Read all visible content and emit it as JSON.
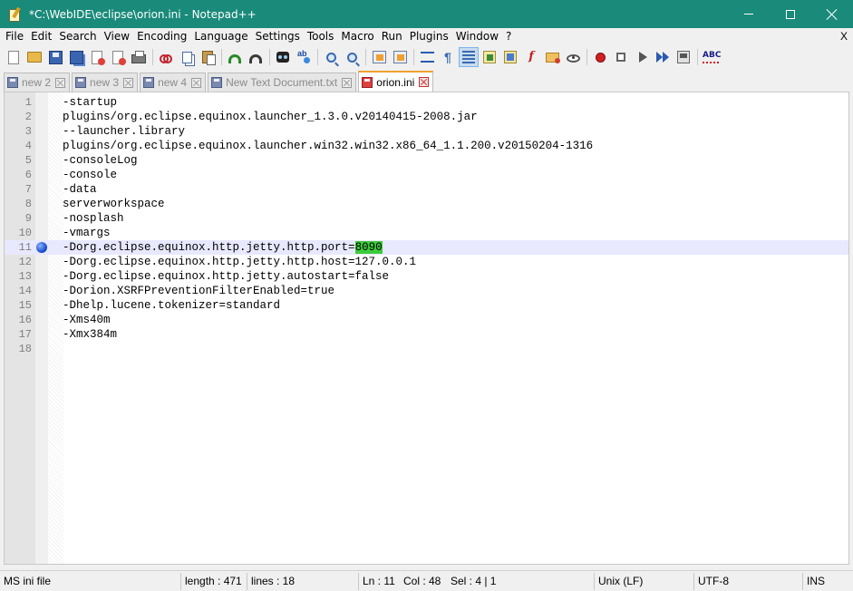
{
  "window": {
    "title": "*C:\\WebIDE\\eclipse\\orion.ini - Notepad++"
  },
  "menu": {
    "items": [
      "File",
      "Edit",
      "Search",
      "View",
      "Encoding",
      "Language",
      "Settings",
      "Tools",
      "Macro",
      "Run",
      "Plugins",
      "Window",
      "?"
    ],
    "close_label": "X"
  },
  "toolbar": {
    "buttons": [
      "new-file",
      "open-file",
      "save",
      "save-all",
      "close",
      "close-all",
      "print",
      "cut",
      "copy",
      "paste",
      "undo",
      "redo",
      "find",
      "replace",
      "zoom-in",
      "zoom-out",
      "sync-scroll-v",
      "sync-scroll-h",
      "word-wrap",
      "show-all-chars",
      "indent-guide",
      "fold-all",
      "user-defined-language",
      "function-list",
      "folder-as-workspace",
      "document-monitor",
      "start-recording",
      "stop-recording",
      "playback",
      "run-macro-multiple",
      "save-macro",
      "spell-check"
    ],
    "spell_label": "ABC"
  },
  "tabs": [
    {
      "label": "new 2",
      "active": false
    },
    {
      "label": "new 3",
      "active": false
    },
    {
      "label": "new 4",
      "active": false
    },
    {
      "label": "New Text Document.txt",
      "active": false
    },
    {
      "label": "orion.ini",
      "active": true
    }
  ],
  "editor": {
    "current_line": 11,
    "bookmark_line": 11,
    "lines": [
      "-startup",
      "plugins/org.eclipse.equinox.launcher_1.3.0.v20140415-2008.jar",
      "--launcher.library",
      "plugins/org.eclipse.equinox.launcher.win32.win32.x86_64_1.1.200.v20150204-1316",
      "-consoleLog",
      "-console",
      "-data",
      "serverworkspace",
      "-nosplash",
      "-vmargs",
      "-Dorg.eclipse.equinox.http.jetty.http.port=8090",
      "-Dorg.eclipse.equinox.http.jetty.http.host=127.0.0.1",
      "-Dorg.eclipse.equinox.http.jetty.autostart=false",
      "-Dorion.XSRFPreventionFilterEnabled=true",
      "-Dhelp.lucene.tokenizer=standard",
      "-Xms40m",
      "-Xmx384m",
      ""
    ],
    "selection": {
      "line": 11,
      "text": "8090"
    }
  },
  "status": {
    "file_type": "MS ini file",
    "length": "length : 471",
    "lines": "lines : 18",
    "ln": "Ln : 11",
    "col": "Col : 48",
    "sel": "Sel : 4 | 1",
    "eol": "Unix (LF)",
    "encoding": "UTF-8",
    "mode": "INS"
  },
  "colors": {
    "titlebar": "#1a8a7a",
    "current_line": "#e8e8ff",
    "selection_highlight": "#3ccc3c",
    "active_tab_accent": "#f0a030"
  }
}
